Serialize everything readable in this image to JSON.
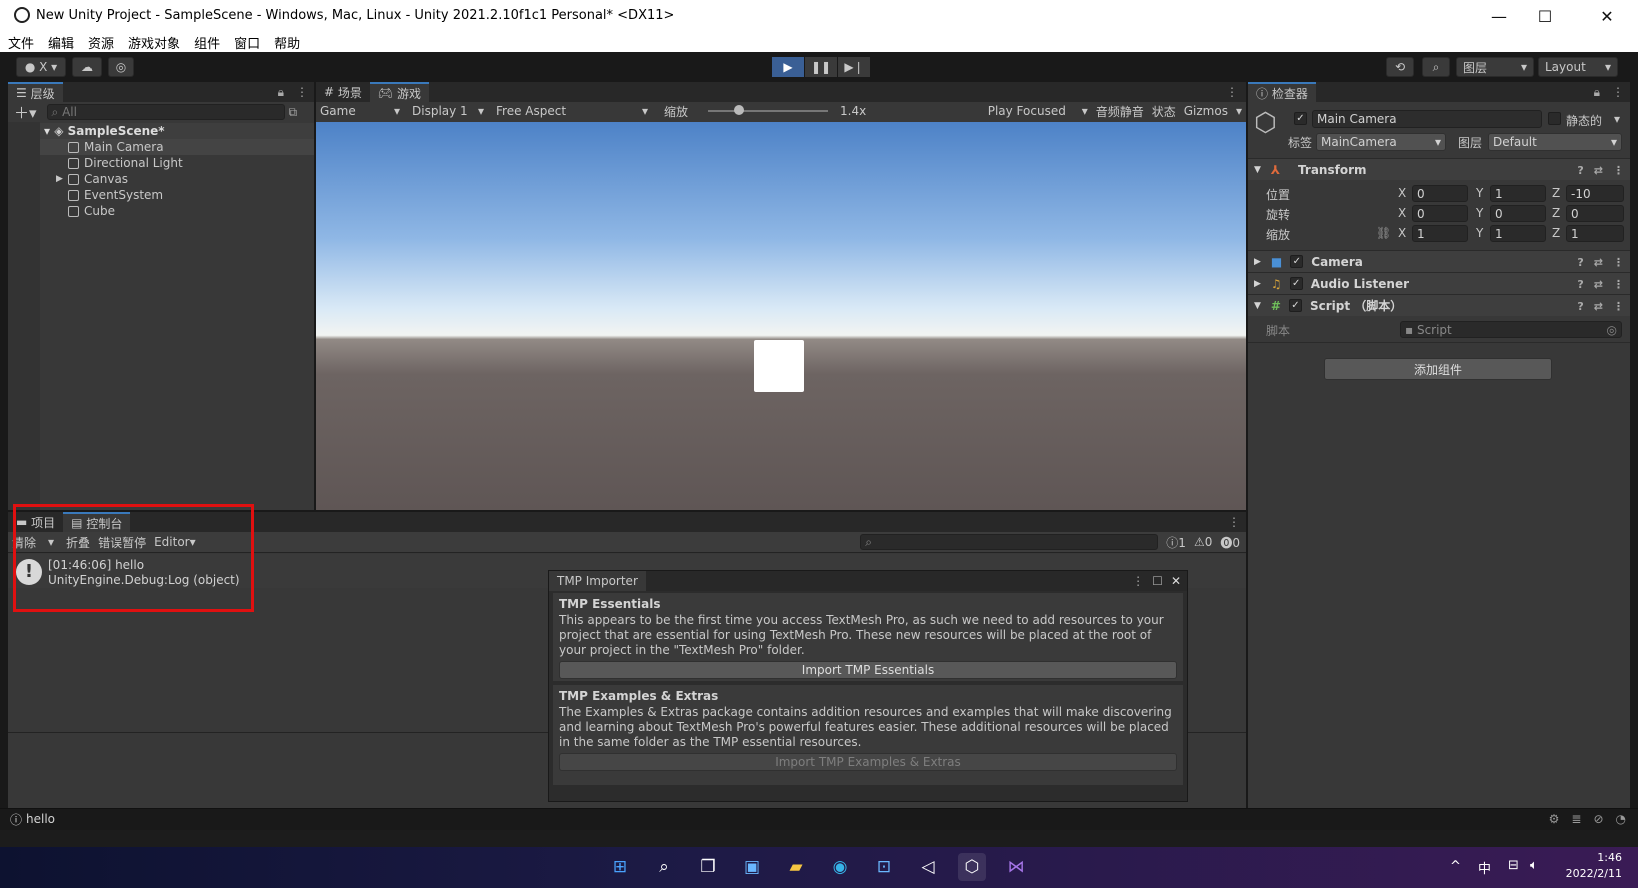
{
  "window": {
    "title": "New Unity Project - SampleScene - Windows, Mac, Linux - Unity 2021.2.10f1c1 Personal* <DX11>",
    "minimize": "—",
    "maximize": "☐",
    "close": "✕"
  },
  "menu": [
    "文件",
    "编辑",
    "资源",
    "游戏对象",
    "组件",
    "窗口",
    "帮助"
  ],
  "toolbar": {
    "account": "X",
    "layers": "图层",
    "layout": "Layout"
  },
  "hierarchy": {
    "tab": "层级",
    "search_placeholder": "All",
    "scene": "SampleScene*",
    "items": [
      "Main Camera",
      "Directional Light",
      "Canvas",
      "EventSystem",
      "Cube"
    ]
  },
  "scene_view": {
    "tab_scene": "场景",
    "tab_game": "游戏",
    "game_dropdown": "Game",
    "display": "Display 1",
    "aspect": "Free Aspect",
    "scale_label": "缩放",
    "scale_value": "1.4x",
    "play_focused": "Play Focused",
    "mute": "音频静音",
    "stats": "状态",
    "gizmos": "Gizmos"
  },
  "inspector": {
    "tab": "检查器",
    "object_name": "Main Camera",
    "static_label": "静态的",
    "tag_label": "标签",
    "tag_value": "MainCamera",
    "layer_label": "图层",
    "layer_value": "Default",
    "transform": {
      "title": "Transform",
      "position_label": "位置",
      "rotation_label": "旋转",
      "scale_label": "缩放",
      "position": {
        "x": "0",
        "y": "1",
        "z": "-10"
      },
      "rotation": {
        "x": "0",
        "y": "0",
        "z": "0"
      },
      "scale": {
        "x": "1",
        "y": "1",
        "z": "1"
      }
    },
    "components": [
      "Camera",
      "Audio Listener",
      "Script （脚本）"
    ],
    "script_label": "脚本",
    "script_value": "Script",
    "add_component": "添加组件"
  },
  "console": {
    "tab_project": "项目",
    "tab_console": "控制台",
    "clear": "清除",
    "collapse": "折叠",
    "error_pause": "错误暂停",
    "editor": "Editor",
    "counts": {
      "log": "1",
      "warning": "0",
      "error": "0"
    },
    "entry_line1": "[01:46:06] hello",
    "entry_line2": "UnityEngine.Debug:Log (object)"
  },
  "tmp_importer": {
    "title": "TMP Importer",
    "essentials_heading": "TMP Essentials",
    "essentials_text": "This appears to be the first time you access TextMesh Pro, as such we need to add resources to your project that are essential for using TextMesh Pro. These new resources will be placed at the root of your project in the \"TextMesh Pro\" folder.",
    "essentials_button": "Import TMP Essentials",
    "extras_heading": "TMP Examples & Extras",
    "extras_text": "The Examples & Extras package contains addition resources and examples that will make discovering and learning about TextMesh Pro's powerful features easier. These additional resources will be placed in the same folder as the TMP essential resources.",
    "extras_button": "Import TMP Examples & Extras"
  },
  "statusbar": {
    "message": "hello"
  },
  "taskbar": {
    "ime": "中",
    "time": "1:46",
    "date": "2022/2/11"
  },
  "colors": {
    "accent": "#3a79bb",
    "highlight_box": "#e01010"
  }
}
